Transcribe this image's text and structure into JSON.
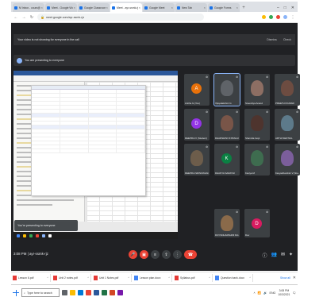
{
  "browser": {
    "tabs": [
      {
        "label": "M Inbox - cours@...",
        "active": false
      },
      {
        "label": "Meet - Google Workspa...",
        "active": false
      },
      {
        "label": "Google Classroom",
        "active": false
      },
      {
        "label": "Meet - ayr-ssmk-rjz",
        "active": true
      },
      {
        "label": "Google Meet",
        "active": false
      },
      {
        "label": "New Tab",
        "active": false
      },
      {
        "label": "Google Forms",
        "active": false
      }
    ],
    "new_tab": "+",
    "address": "meet.google.com/ayr-ssmk-rjz"
  },
  "meet": {
    "banner_text": "Your video is not showing for everyone in the call",
    "banner_actions": [
      "Dismiss",
      "Check"
    ],
    "presenting_chip": "You are presenting to everyone",
    "present_tip": "You're presenting to everyone",
    "meeting_time": "3:08 PM",
    "meeting_code": "ayr-ssmk-rjz",
    "participants": [
      {
        "name": "Anitha G (You)",
        "letter": "A",
        "color": "#e8710a",
        "photo": false
      },
      {
        "name": "Vijayalakshmi G",
        "letter": "",
        "color": "#5f6368",
        "photo": true,
        "speaking": true
      },
      {
        "name": "Sreevidya Anand",
        "letter": "",
        "color": "#8d6e63",
        "photo": true
      },
      {
        "name": "PREETHI KUMAR",
        "letter": "",
        "color": "#6d4c41",
        "photo": true
      },
      {
        "name": "DEEPIKA V (Student)",
        "letter": "D",
        "color": "#9334e6",
        "photo": false
      },
      {
        "name": "DHARSHINI R PRAGU",
        "letter": "",
        "color": "#795548",
        "photo": true
      },
      {
        "name": "Sharmila Gopi",
        "letter": "",
        "color": "#4e342e",
        "photo": true
      },
      {
        "name": "ARTHI SENTHIL",
        "letter": "",
        "color": "#5d7a8a",
        "photo": true
      },
      {
        "name": "DEEPIKA SRINIVASAN",
        "letter": "",
        "color": "#6d5d4b",
        "photo": true
      },
      {
        "name": "DHANYA SARATHI",
        "letter": "K",
        "color": "#0b8043",
        "photo": false
      },
      {
        "name": "Kaviya M",
        "letter": "",
        "color": "#3e6c4f",
        "photo": true
      },
      {
        "name": "Kavyadharshini V (Stu...",
        "letter": "",
        "color": "#7b5e9b",
        "photo": true
      },
      {
        "name": "DIVYADHARSHINI RAJA",
        "letter": "",
        "color": "#8a6a4a",
        "photo": true
      },
      {
        "name": "Dev",
        "letter": "D",
        "color": "#d81b60",
        "photo": false
      }
    ]
  },
  "downloads": [
    {
      "name": "Lesson 6.pdf",
      "pdf": true
    },
    {
      "name": "Unit 2 notes.pdf",
      "pdf": true
    },
    {
      "name": "Unit 1 Notes.pdf",
      "pdf": true
    },
    {
      "name": "Lesson plan.docx",
      "pdf": false
    },
    {
      "name": "Syllabus.pdf",
      "pdf": true
    },
    {
      "name": "Question bank.docx",
      "pdf": false
    }
  ],
  "downloads_show_all": "Show all",
  "taskbar": {
    "search_placeholder": "Type here to search",
    "time": "3:08 PM",
    "date": "10/3/2021",
    "lang": "ENG"
  },
  "colors": {
    "meet_bg": "#202124",
    "tile_bg": "#3c4043",
    "end_call": "#ea4335"
  }
}
